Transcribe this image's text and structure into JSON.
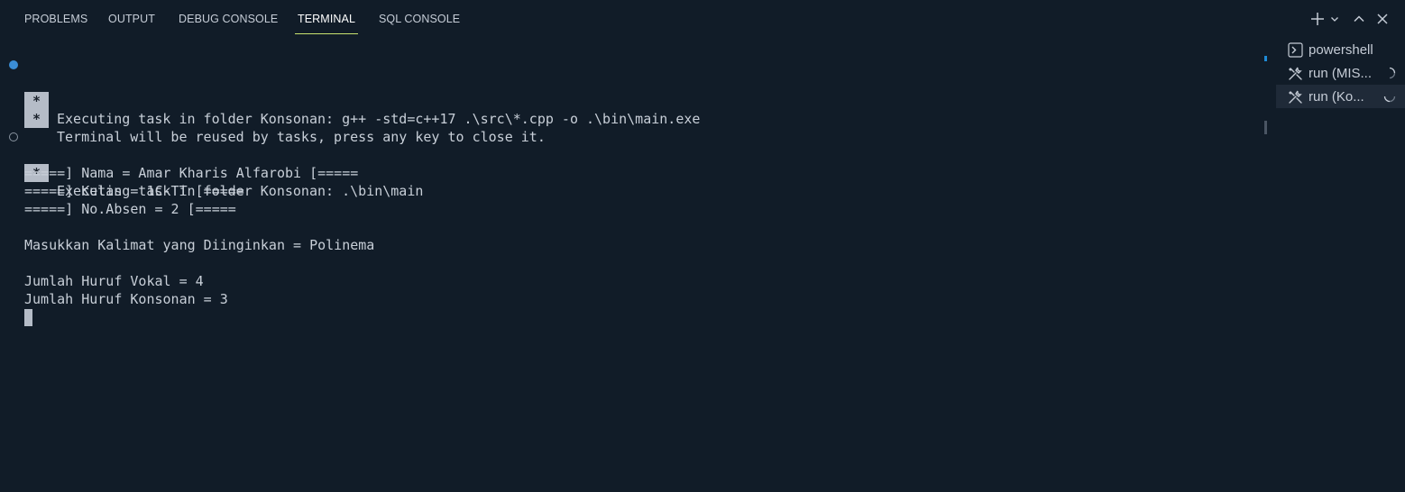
{
  "tabs": [
    {
      "label": "PROBLEMS"
    },
    {
      "label": "OUTPUT"
    },
    {
      "label": "DEBUG CONSOLE"
    },
    {
      "label": "TERMINAL",
      "active": true
    },
    {
      "label": "SQL CONSOLE"
    }
  ],
  "actions": {
    "icons": [
      "plus-icon",
      "chevron-down-icon",
      "chevron-up-icon",
      "close-icon"
    ]
  },
  "terminal": {
    "task_lines": [
      {
        "badge": "*",
        "text": "Executing task in folder Konsonan: g++ -std=c++17 .\\src\\*.cpp -o .\\bin\\main.exe",
        "decoration": "filled"
      },
      {
        "badge": "*",
        "text": "Terminal will be reused by tasks, press any key to close it.",
        "decoration": "none"
      },
      {
        "badge": "*",
        "text": "Executing task in folder Konsonan: .\\bin\\main",
        "decoration": "hollow"
      }
    ],
    "output_lines": [
      "=====] Nama = Amar Kharis Alfarobi [=====",
      "=====] Kelas = 1C-TT [=====",
      "=====] No.Absen = 2 [=====",
      "Masukkan Kalimat yang Diinginkan = Polinema",
      "Jumlah Huruf Vokal = 4",
      "Jumlah Huruf Konsonan = 3"
    ]
  },
  "terminal_list": [
    {
      "label": "powershell",
      "icon": "terminal-icon",
      "selected": false,
      "loading": false
    },
    {
      "label": "run (MIS...",
      "icon": "tools-icon",
      "selected": false,
      "loading": true
    },
    {
      "label": "run (Ko...",
      "icon": "tools-icon",
      "selected": true,
      "loading": true
    }
  ],
  "colors": {
    "background": "#111c28",
    "active_tab_underline": "#c9e36f",
    "decoration_filled": "#3b8ed6",
    "scroll_marker": "#1e8ad6"
  }
}
